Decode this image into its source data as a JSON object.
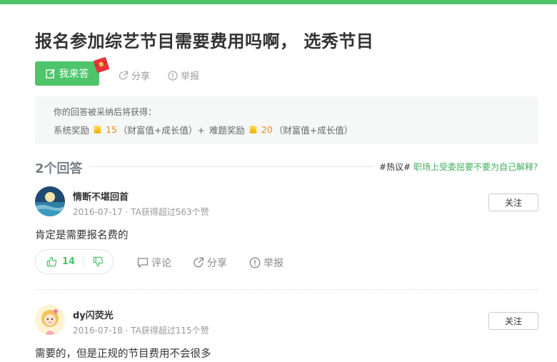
{
  "question": {
    "title": "报名参加综艺节目需要费用吗啊， 选秀节目",
    "answer_button": "我来答",
    "share": "分享",
    "report": "举报"
  },
  "reward": {
    "intro": "你的回答被采纳后将获得：",
    "system_label": "系统奖励",
    "system_value": "15",
    "system_unit": "（财富值+成长值）+",
    "hard_label": "难题奖励",
    "hard_value": "20",
    "hard_unit": "（财富值+成长值）"
  },
  "answers_header": {
    "count": "2个回答",
    "hot_tag": "#热议#",
    "hot_link": "职场上受委屈要不要为自己解释?"
  },
  "answers": [
    {
      "username": "情断不堪回首",
      "meta": "2016-07-17 · TA获得超过563个赞",
      "follow": "关注",
      "text": "肯定是需要报名费的",
      "likes": "14",
      "comment": "评论",
      "share": "分享",
      "report": "举报"
    },
    {
      "username": "dy闪荧光",
      "meta": "2016-07-18 · TA获得超过115个赞",
      "follow": "关注",
      "text": "需要的，但是正规的节目费用不会很多"
    }
  ],
  "colors": {
    "brand_green": "#4ec46b",
    "link_green": "#3eaf5c",
    "coin_orange": "#f08a1a"
  },
  "icons": [
    "edit-icon",
    "red-envelope-icon",
    "share-icon",
    "report-icon",
    "coin-icon",
    "thumbs-up-icon",
    "thumbs-down-icon",
    "comment-icon"
  ]
}
